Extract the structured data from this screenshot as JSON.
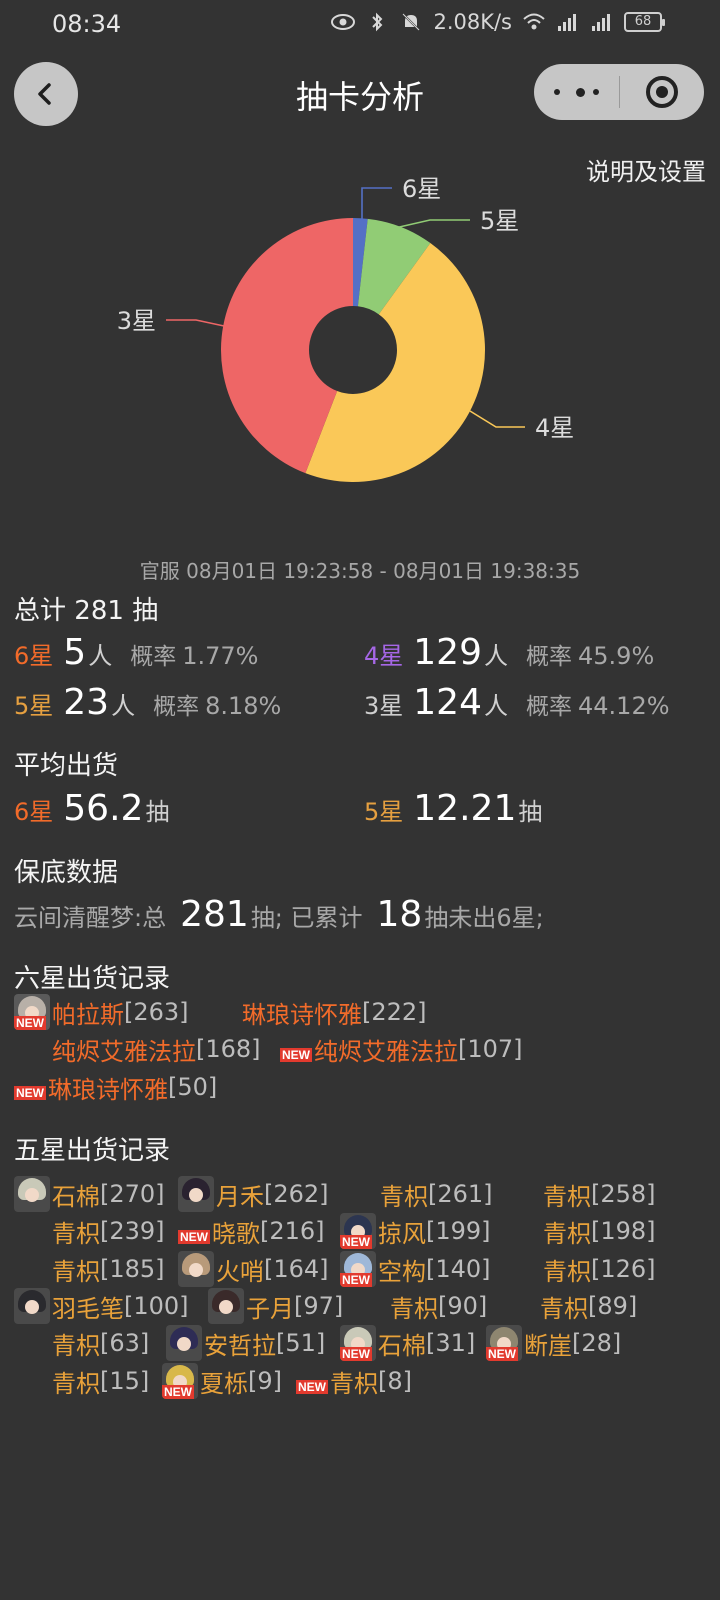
{
  "status": {
    "time": "08:34",
    "speed": "2.08K/s",
    "battery": "68",
    "net1": "4G",
    "net2": "4G"
  },
  "nav": {
    "title": "抽卡分析"
  },
  "settings_link": "说明及设置",
  "chart_data": {
    "type": "pie",
    "donut": true,
    "categories": [
      "6星",
      "5星",
      "4星",
      "3星"
    ],
    "values": [
      5,
      23,
      129,
      124
    ],
    "colors": [
      "#5470c6",
      "#91cc75",
      "#fac858",
      "#ee6666"
    ]
  },
  "time_range": "官服 08月01日 19:23:58 - 08月01日 19:38:35",
  "total": {
    "label": "总计",
    "count": "281",
    "unit": "抽"
  },
  "stats": [
    {
      "star": "6星",
      "count": "5",
      "unit": "人",
      "prob_label": "概率",
      "prob": "1.77%",
      "color": "#f26b2a"
    },
    {
      "star": "4星",
      "count": "129",
      "unit": "人",
      "prob_label": "概率",
      "prob": "45.9%",
      "color": "#a667e6"
    },
    {
      "star": "5星",
      "count": "23",
      "unit": "人",
      "prob_label": "概率",
      "prob": "8.18%",
      "color": "#e6a040"
    },
    {
      "star": "3星",
      "count": "124",
      "unit": "人",
      "prob_label": "概率",
      "prob": "44.12%",
      "color": "#cfcfcf"
    }
  ],
  "average": {
    "title": "平均出货",
    "six_label": "6星",
    "six_value": "56.2",
    "five_label": "5星",
    "five_value": "12.21",
    "unit": "抽"
  },
  "pity": {
    "title": "保底数据",
    "pool": "云间清醒梦:总",
    "total": "281",
    "mid": "抽; 已累计",
    "since": "18",
    "tail": "抽未出6星;"
  },
  "six_records": {
    "title": "六星出货记录",
    "items": [
      {
        "name": "帕拉斯",
        "pull": "[263]",
        "new": "NEW",
        "avatar": true
      },
      {
        "name": "琳琅诗怀雅",
        "pull": "[222]",
        "new": "",
        "avatar": false
      },
      {
        "name": "纯烬艾雅法拉",
        "pull": "[168]",
        "new": "",
        "avatar": false
      },
      {
        "name": "纯烬艾雅法拉",
        "pull": "[107]",
        "new": "NEW",
        "avatar": false
      },
      {
        "name": "琳琅诗怀雅",
        "pull": "[50]",
        "new": "NEW",
        "avatar": false
      }
    ]
  },
  "five_records": {
    "title": "五星出货记录",
    "items": [
      {
        "name": "石棉",
        "pull": "[270]",
        "new": "",
        "avatar": true,
        "hair": "#c9c9b8"
      },
      {
        "name": "月禾",
        "pull": "[262]",
        "new": "",
        "avatar": true,
        "hair": "#2a2230"
      },
      {
        "name": "青枳",
        "pull": "[261]",
        "new": "",
        "avatar": false
      },
      {
        "name": "青枳",
        "pull": "[258]",
        "new": "",
        "avatar": false
      },
      {
        "name": "青枳",
        "pull": "[239]",
        "new": "",
        "avatar": false
      },
      {
        "name": "晓歌",
        "pull": "[216]",
        "new": "NEW",
        "avatar": false
      },
      {
        "name": "掠风",
        "pull": "[199]",
        "new": "NEW",
        "avatar": true,
        "hair": "#2c3550"
      },
      {
        "name": "青枳",
        "pull": "[198]",
        "new": "",
        "avatar": false
      },
      {
        "name": "青枳",
        "pull": "[185]",
        "new": "",
        "avatar": false
      },
      {
        "name": "火哨",
        "pull": "[164]",
        "new": "",
        "avatar": true,
        "hair": "#b89a7a"
      },
      {
        "name": "空构",
        "pull": "[140]",
        "new": "NEW",
        "avatar": true,
        "hair": "#9fb8d8"
      },
      {
        "name": "青枳",
        "pull": "[126]",
        "new": "",
        "avatar": false
      },
      {
        "name": "羽毛笔",
        "pull": "[100]",
        "new": "",
        "avatar": true,
        "hair": "#2a2a2e"
      },
      {
        "name": "子月",
        "pull": "[97]",
        "new": "",
        "avatar": true,
        "hair": "#3a2a2a"
      },
      {
        "name": "青枳",
        "pull": "[90]",
        "new": "",
        "avatar": false
      },
      {
        "name": "青枳",
        "pull": "[89]",
        "new": "",
        "avatar": false
      },
      {
        "name": "青枳",
        "pull": "[63]",
        "new": "",
        "avatar": false
      },
      {
        "name": "安哲拉",
        "pull": "[51]",
        "new": "",
        "avatar": true,
        "hair": "#2e2c55"
      },
      {
        "name": "石棉",
        "pull": "[31]",
        "new": "NEW",
        "avatar": true,
        "hair": "#c9c9b8"
      },
      {
        "name": "断崖",
        "pull": "[28]",
        "new": "NEW",
        "avatar": true,
        "hair": "#8e8670"
      },
      {
        "name": "青枳",
        "pull": "[15]",
        "new": "",
        "avatar": false
      },
      {
        "name": "夏栎",
        "pull": "[9]",
        "new": "NEW",
        "avatar": true,
        "hair": "#d8b84a"
      },
      {
        "name": "青枳",
        "pull": "[8]",
        "new": "NEW",
        "avatar": false
      }
    ]
  }
}
